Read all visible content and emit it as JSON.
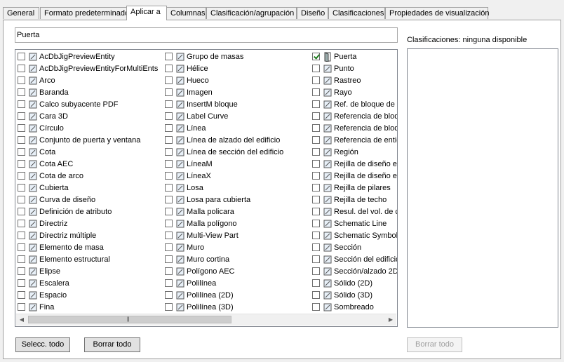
{
  "tabs": [
    {
      "label": "General",
      "active": false
    },
    {
      "label": "Formato predeterminado",
      "active": false
    },
    {
      "label": "Aplicar a",
      "active": true
    },
    {
      "label": "Columnas",
      "active": false
    },
    {
      "label": "Clasificación/agrupación",
      "active": false
    },
    {
      "label": "Diseño",
      "active": false
    },
    {
      "label": "Clasificaciones",
      "active": false
    },
    {
      "label": "Propiedades de visualización",
      "active": false
    }
  ],
  "search": {
    "value": "Puerta"
  },
  "columns": [
    [
      {
        "label": "AcDbJigPreviewEntity",
        "icon": "doc-icon",
        "checked": false
      },
      {
        "label": "AcDbJigPreviewEntityForMultiEnts",
        "icon": "doc-icon",
        "checked": false
      },
      {
        "label": "Arco",
        "icon": "arc-icon",
        "checked": false
      },
      {
        "label": "Baranda",
        "icon": "railing-icon",
        "checked": false
      },
      {
        "label": "Calco subyacente PDF",
        "icon": "pdf-icon",
        "checked": false
      },
      {
        "label": "Cara 3D",
        "icon": "face3d-icon",
        "checked": false
      },
      {
        "label": "Círculo",
        "icon": "circle-icon",
        "checked": false
      },
      {
        "label": "Conjunto de puerta y ventana",
        "icon": "door-window-icon",
        "checked": false
      },
      {
        "label": "Cota",
        "icon": "dimension-icon",
        "checked": false
      },
      {
        "label": "Cota AEC",
        "icon": "aec-dimension-icon",
        "checked": false
      },
      {
        "label": "Cota de arco",
        "icon": "arc-dimension-icon",
        "checked": false
      },
      {
        "label": "Cubierta",
        "icon": "roof-icon",
        "checked": false
      },
      {
        "label": "Curva de diseño",
        "icon": "curve-icon",
        "checked": false
      },
      {
        "label": "Definición de atributo",
        "icon": "attribute-icon",
        "checked": false
      },
      {
        "label": "Directriz",
        "icon": "leader-icon",
        "checked": false
      },
      {
        "label": "Directriz múltiple",
        "icon": "multileader-icon",
        "checked": false
      },
      {
        "label": "Elemento de masa",
        "icon": "mass-element-icon",
        "checked": false
      },
      {
        "label": "Elemento estructural",
        "icon": "structural-icon",
        "checked": false
      },
      {
        "label": "Elipse",
        "icon": "ellipse-icon",
        "checked": false
      },
      {
        "label": "Escalera",
        "icon": "stair-icon",
        "checked": false
      },
      {
        "label": "Espacio",
        "icon": "space-icon",
        "checked": false
      },
      {
        "label": "Fina",
        "icon": "sun-icon",
        "checked": false
      }
    ],
    [
      {
        "label": "Grupo de masas",
        "icon": "mass-group-icon",
        "checked": false
      },
      {
        "label": "Hélice",
        "icon": "helix-icon",
        "checked": false
      },
      {
        "label": "Hueco",
        "icon": "opening-icon",
        "checked": false
      },
      {
        "label": "Imagen",
        "icon": "image-icon",
        "checked": false
      },
      {
        "label": "InsertM bloque",
        "icon": "minsert-icon",
        "checked": false
      },
      {
        "label": "Label Curve",
        "icon": "label-curve-icon",
        "checked": false
      },
      {
        "label": "Línea",
        "icon": "line-icon",
        "checked": false
      },
      {
        "label": "Línea de alzado del edificio",
        "icon": "elevation-line-icon",
        "checked": false
      },
      {
        "label": "Línea de sección del edificio",
        "icon": "section-line-icon",
        "checked": false
      },
      {
        "label": "LíneaM",
        "icon": "mline-icon",
        "checked": false
      },
      {
        "label": "LíneaX",
        "icon": "xline-icon",
        "checked": false
      },
      {
        "label": "Losa",
        "icon": "slab-icon",
        "checked": false
      },
      {
        "label": "Losa para cubierta",
        "icon": "roof-slab-icon",
        "checked": false
      },
      {
        "label": "Malla policara",
        "icon": "polyface-icon",
        "checked": false
      },
      {
        "label": "Malla polígono",
        "icon": "polygon-mesh-icon",
        "checked": false
      },
      {
        "label": "Multi-View Part",
        "icon": "mvpart-icon",
        "checked": false
      },
      {
        "label": "Muro",
        "icon": "wall-icon",
        "checked": false
      },
      {
        "label": "Muro cortina",
        "icon": "curtain-wall-icon",
        "checked": false
      },
      {
        "label": "Polígono AEC",
        "icon": "polygon-icon",
        "checked": false
      },
      {
        "label": "Polilínea",
        "icon": "polyline-icon",
        "checked": false
      },
      {
        "label": "Polilínea (2D)",
        "icon": "polyline2d-icon",
        "checked": false
      },
      {
        "label": "Polilínea (3D)",
        "icon": "polyline3d-icon",
        "checked": false
      }
    ],
    [
      {
        "label": "Puerta",
        "icon": "door-icon",
        "checked": true
      },
      {
        "label": "Punto",
        "icon": "point-icon",
        "checked": false
      },
      {
        "label": "Rastreo",
        "icon": "trace-icon",
        "checked": false
      },
      {
        "label": "Rayo",
        "icon": "ray-icon",
        "checked": false
      },
      {
        "label": "Ref. de bloque de m",
        "icon": "block-ref-icon",
        "checked": false
      },
      {
        "label": "Referencia de bloq",
        "icon": "block-ref-icon",
        "checked": false
      },
      {
        "label": "Referencia de bloq",
        "icon": "block-ref-icon",
        "checked": false
      },
      {
        "label": "Referencia de entic",
        "icon": "entity-ref-icon",
        "checked": false
      },
      {
        "label": "Región",
        "icon": "region-icon",
        "checked": false
      },
      {
        "label": "Rejilla de diseño er",
        "icon": "grid-icon",
        "checked": false
      },
      {
        "label": "Rejilla de diseño er",
        "icon": "grid-icon",
        "checked": false
      },
      {
        "label": "Rejilla de pilares",
        "icon": "column-grid-icon",
        "checked": false
      },
      {
        "label": "Rejilla de techo",
        "icon": "ceiling-grid-icon",
        "checked": false
      },
      {
        "label": "Resul. del vol. de c",
        "icon": "volume-icon",
        "checked": false
      },
      {
        "label": "Schematic Line",
        "icon": "schematic-line-icon",
        "checked": false
      },
      {
        "label": "Schematic Symbol",
        "icon": "schematic-symbol-icon",
        "checked": false
      },
      {
        "label": "Sección",
        "icon": "section-icon",
        "checked": false
      },
      {
        "label": "Sección del edificio",
        "icon": "building-section-icon",
        "checked": false
      },
      {
        "label": "Sección/alzado 2D",
        "icon": "section-elevation-icon",
        "checked": false
      },
      {
        "label": "Sólido (2D)",
        "icon": "solid2d-icon",
        "checked": false
      },
      {
        "label": "Sólido (3D)",
        "icon": "solid3d-icon",
        "checked": false
      },
      {
        "label": "Sombreado",
        "icon": "hatch-icon",
        "checked": false
      }
    ]
  ],
  "buttons": {
    "select_all": "Selecc. todo",
    "clear_all": "Borrar todo",
    "clear_all_classifications": "Borrar todo"
  },
  "classifications": {
    "label": "Clasificaciones: ninguna disponible"
  }
}
